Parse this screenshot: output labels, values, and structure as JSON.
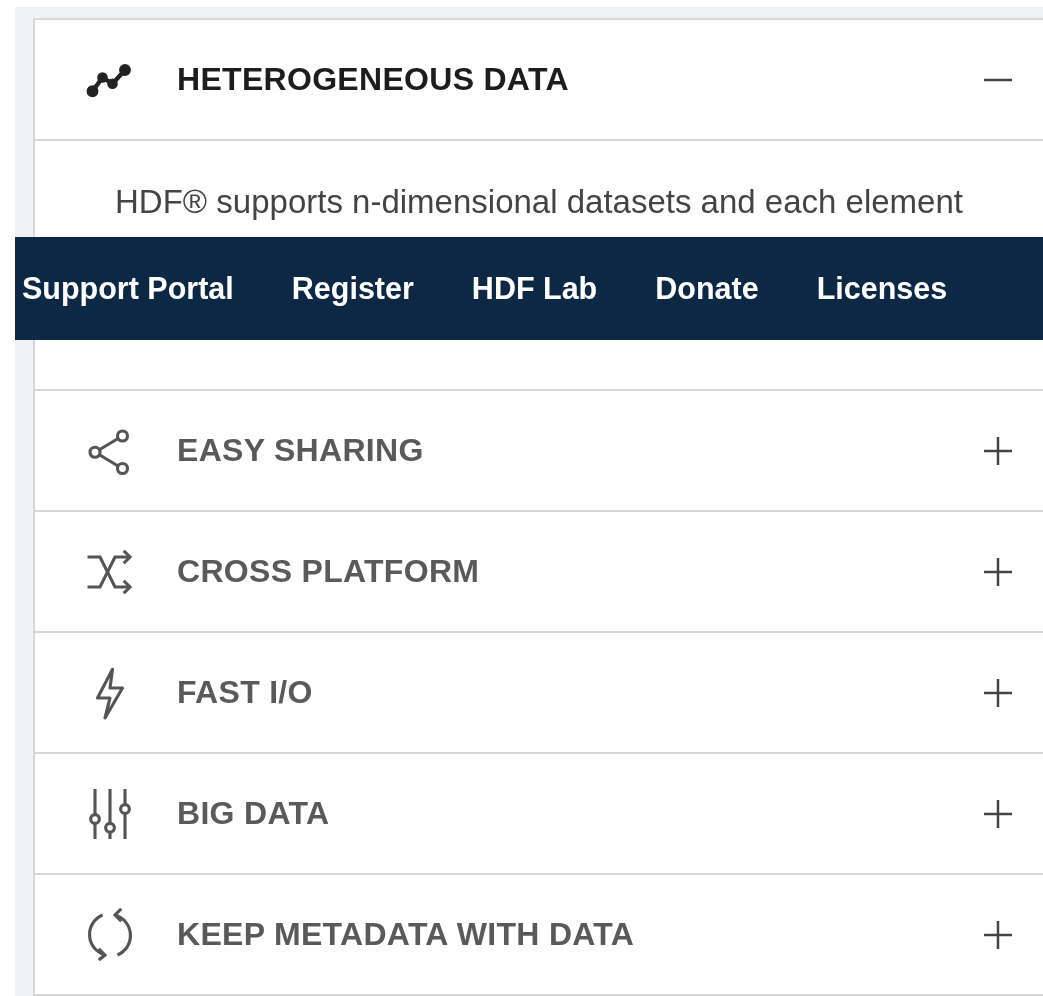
{
  "accordion": [
    {
      "title": "HETEROGENEOUS DATA",
      "expanded": true,
      "body": "HDF® supports n-dimensional datasets and each element"
    },
    {
      "title": "EASY SHARING",
      "expanded": false
    },
    {
      "title": "CROSS PLATFORM",
      "expanded": false
    },
    {
      "title": "FAST I/O",
      "expanded": false
    },
    {
      "title": "BIG DATA",
      "expanded": false
    },
    {
      "title": "KEEP METADATA WITH DATA",
      "expanded": false
    }
  ],
  "nav": {
    "links": [
      "Support Portal",
      "Register",
      "HDF Lab",
      "Donate",
      "Licenses"
    ]
  }
}
